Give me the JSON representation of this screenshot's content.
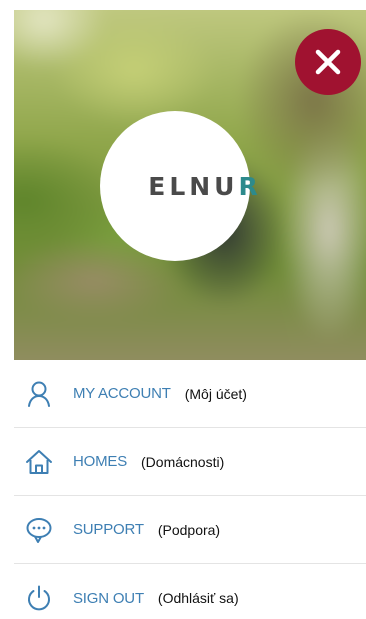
{
  "brand": {
    "logo_text": "ELNUR"
  },
  "menu": {
    "items": [
      {
        "label": "MY ACCOUNT",
        "note": "(Môj účet)",
        "icon": "user-icon"
      },
      {
        "label": "HOMES",
        "note": "(Domácnosti)",
        "icon": "home-icon"
      },
      {
        "label": "SUPPORT",
        "note": "(Podpora)",
        "icon": "chat-icon"
      },
      {
        "label": "SIGN OUT",
        "note": "(Odhlásiť sa)",
        "icon": "power-icon"
      }
    ]
  },
  "colors": {
    "accent": "#3e7fb3",
    "close_button": "#a01230",
    "logo_accent": "#2d8a8c"
  }
}
